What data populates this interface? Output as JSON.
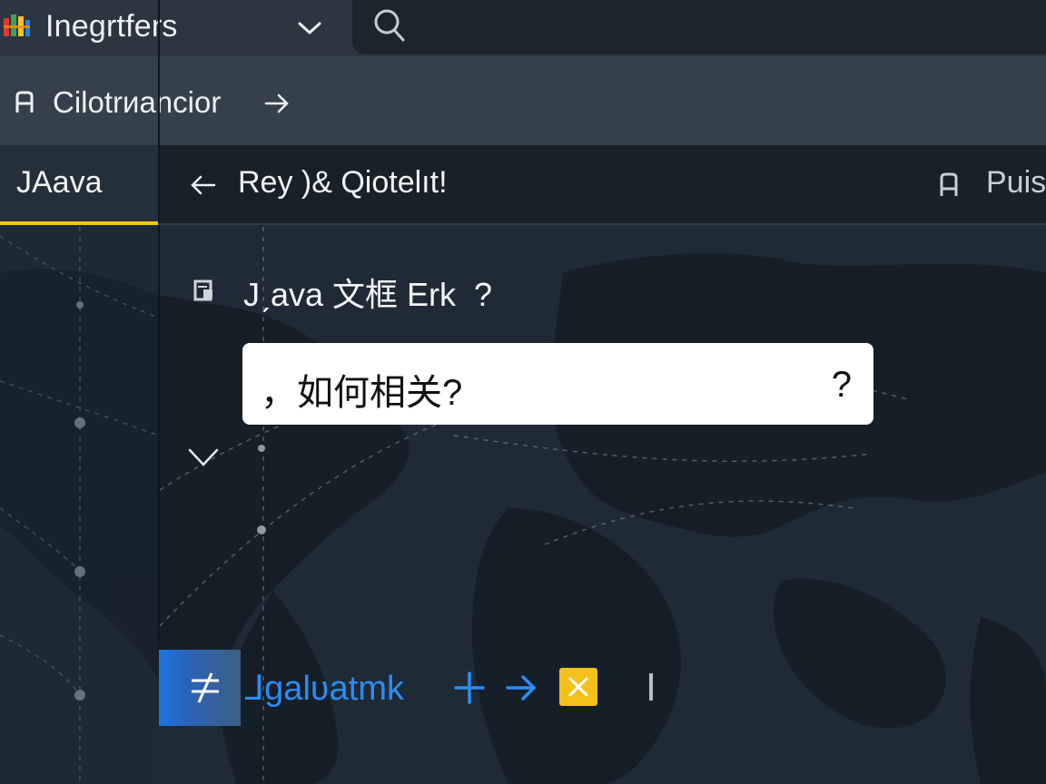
{
  "colors": {
    "background": "#1e2a35",
    "topbar": "#2b3641",
    "accent_yellow": "#f0c419",
    "accent_blue": "#2b8df5"
  },
  "topbar": {
    "app_title": "Inegrtfers",
    "logo_icon": "app-logo-icon",
    "switch_icon": "chevron-down-icon",
    "search_icon": "search-icon"
  },
  "breadcrumb": {
    "label": "Cilotrиancior",
    "icon": "bookmark-icon",
    "arrow_icon": "arrow-right-icon"
  },
  "tabs": {
    "active_tab": "JAava",
    "title": "Rey )& Qiotelıt!",
    "right_label": "Puis",
    "back_icon": "arrow-left-icon",
    "right_icon": "bookmark-icon"
  },
  "question": {
    "icon": "document-icon",
    "text": "Jˏava 文框 Erk  ?"
  },
  "answer": {
    "text": "，如何相关?",
    "help": "?"
  },
  "actions": {
    "label": "⅃galʋatmk",
    "button_icon": "not-equal-icon",
    "plus_icon": "plus-icon",
    "arrow_icon": "arrow-right-icon",
    "close_icon": "close-icon"
  }
}
